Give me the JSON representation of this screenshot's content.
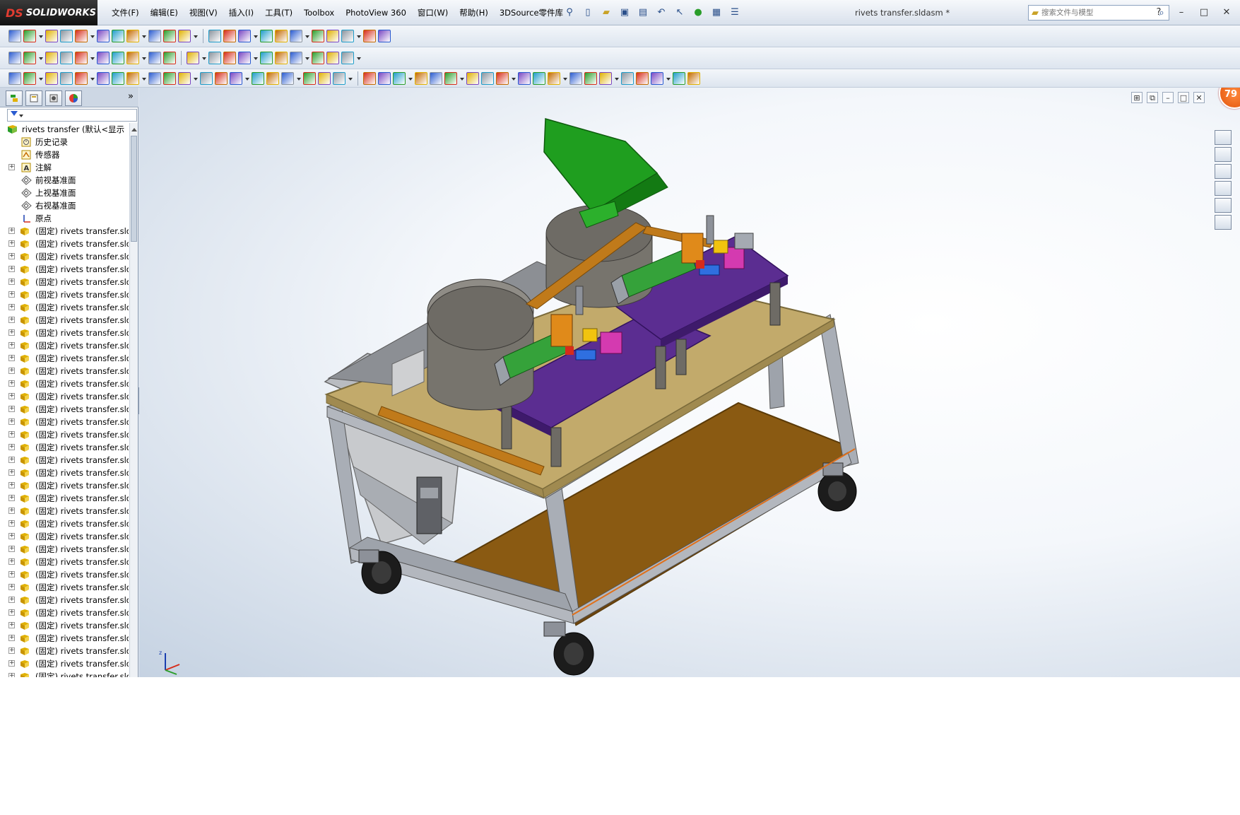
{
  "app": {
    "brand": "SOLIDWORKS",
    "brand_prefix": "DS",
    "document_title": "rivets transfer.sldasm *"
  },
  "menu": [
    "文件(F)",
    "编辑(E)",
    "视图(V)",
    "插入(I)",
    "工具(T)",
    "Toolbox",
    "PhotoView 360",
    "窗口(W)",
    "帮助(H)",
    "3DSource零件库"
  ],
  "search": {
    "placeholder": "搜索文件与模型"
  },
  "window_controls": {
    "minimize": "–",
    "maximize": "□",
    "close": "✕",
    "help": "?"
  },
  "tree": {
    "root_label": "rivets transfer  (默认<显示",
    "items": [
      {
        "label": "历史记录",
        "icon": "history-icon",
        "expandable": false
      },
      {
        "label": "传感器",
        "icon": "sensor-icon",
        "expandable": false
      },
      {
        "label": "注解",
        "icon": "annotation-icon",
        "expandable": true
      },
      {
        "label": "前视基准面",
        "icon": "plane-icon",
        "expandable": false
      },
      {
        "label": "上视基准面",
        "icon": "plane-icon",
        "expandable": false
      },
      {
        "label": "右视基准面",
        "icon": "plane-icon",
        "expandable": false
      },
      {
        "label": "原点",
        "icon": "origin-icon",
        "expandable": false
      }
    ],
    "component_label": "(固定) rivets transfer.sldasm",
    "component_count": 36
  },
  "view_controls": [
    "tile-icon",
    "restore-icon",
    "minimize-icon",
    "maximize-icon",
    "close-icon"
  ],
  "zoom_badge": "79",
  "colors": {
    "menubar": "#dfe6ef",
    "frame": "#a9aeb6",
    "tabletop": "#c2aa6b",
    "shelf": "#8a5a12",
    "plate": "#5b2d91",
    "hopper": "#6e6b65",
    "chute": "#1f9e1f",
    "accent_orange": "#e2530b"
  }
}
